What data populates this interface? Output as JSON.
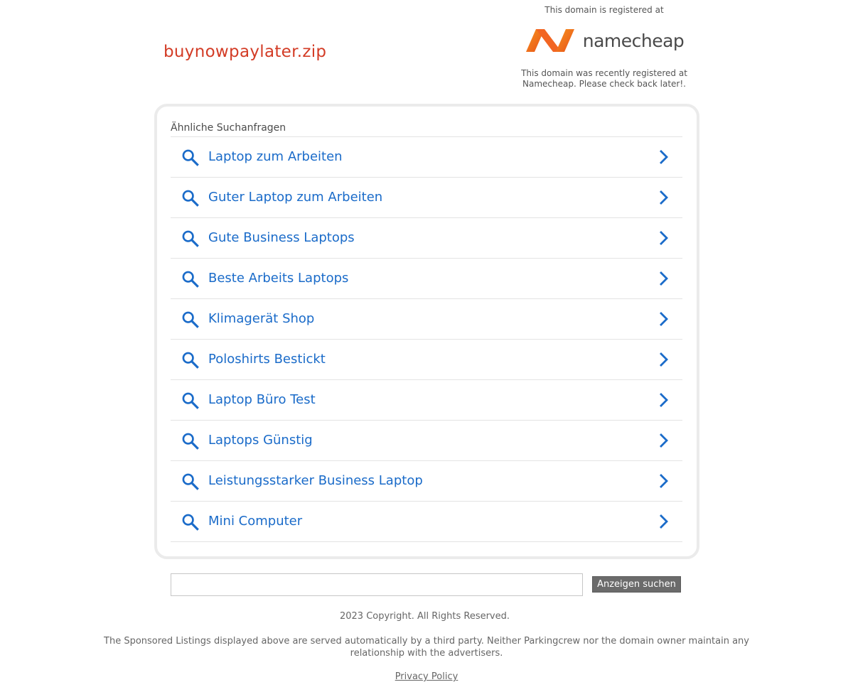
{
  "header": {
    "domain": "buynowpaylater.zip",
    "registrar_top": "This domain is registered at",
    "registrar_logo_text": "namecheap",
    "registrar_note": "This domain was recently registered at Namecheap. Please check back later!."
  },
  "related": {
    "title": "Ähnliche Suchanfragen",
    "items": [
      {
        "label": "Laptop zum Arbeiten"
      },
      {
        "label": "Guter Laptop zum Arbeiten"
      },
      {
        "label": "Gute Business Laptops"
      },
      {
        "label": "Beste Arbeits Laptops"
      },
      {
        "label": "Klimagerät Shop"
      },
      {
        "label": "Poloshirts Bestickt"
      },
      {
        "label": "Laptop Büro Test"
      },
      {
        "label": "Laptops Günstig"
      },
      {
        "label": "Leistungsstarker Business Laptop"
      },
      {
        "label": "Mini Computer"
      }
    ]
  },
  "search": {
    "value": "",
    "placeholder": "",
    "button_label": "Anzeigen suchen"
  },
  "footer": {
    "copyright": "2023 Copyright. All Rights Reserved.",
    "disclaimer": "The Sponsored Listings displayed above are served automatically by a third party. Neither Parkingcrew nor the domain owner maintain any relationship with the advertisers.",
    "privacy_label": "Privacy Policy"
  },
  "colors": {
    "domain_title": "#d33c26",
    "link_blue": "#1a6bc9",
    "namecheap_orange": "#f26522",
    "button_gray": "#6b6b6b"
  },
  "icons": {
    "item_left": "search-icon",
    "item_right": "chevron-right-icon"
  }
}
